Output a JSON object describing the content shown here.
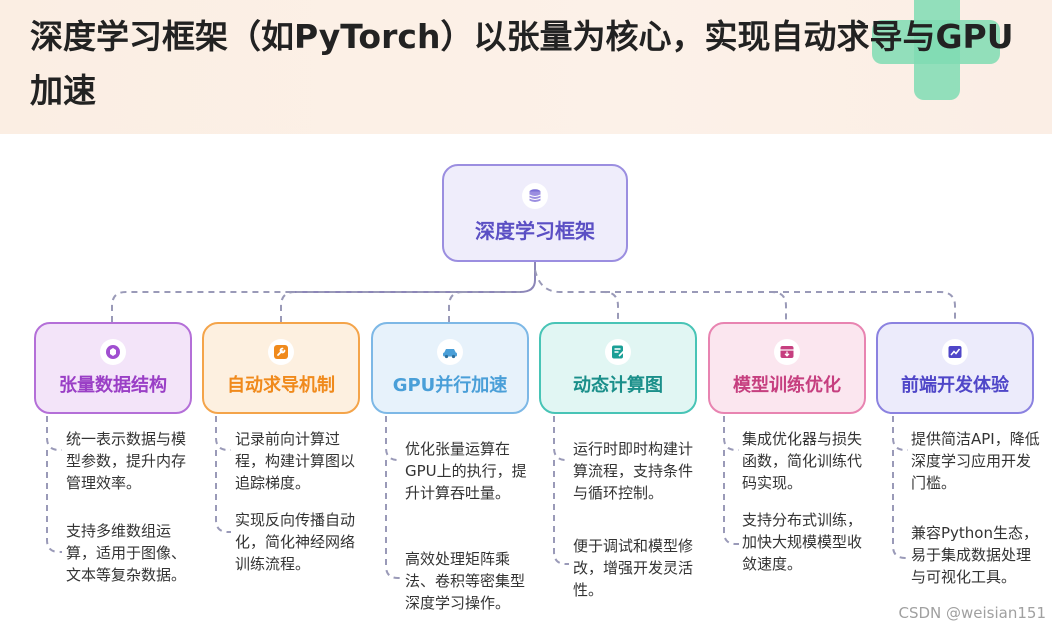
{
  "header": {
    "title": "深度学习框架（如PyTorch）以张量为核心，实现自动求导与GPU加速"
  },
  "root": {
    "label": "深度学习框架",
    "icon": "database-icon",
    "color": "#5b4fc4"
  },
  "branches": [
    {
      "label": "张量数据结构",
      "icon": "cube-icon",
      "color": "#9a3fc6",
      "bg": "#f3e4f9",
      "bullets": [
        "统一表示数据与模型参数，提升内存管理效率。",
        "支持多维数组运算，适用于图像、文本等复杂数据。"
      ]
    },
    {
      "label": "自动求导机制",
      "icon": "wrench-icon",
      "color": "#f08a1c",
      "bg": "#fdf0e0",
      "bullets": [
        "记录前向计算过程，构建计算图以追踪梯度。",
        "实现反向传播自动化，简化神经网络训练流程。"
      ]
    },
    {
      "label": "GPU并行加速",
      "icon": "car-icon",
      "color": "#4a9fd8",
      "bg": "#e7f2fb",
      "bullets": [
        "优化张量运算在GPU上的执行，提升计算吞吐量。",
        "高效处理矩阵乘法、卷积等密集型深度学习操作。"
      ]
    },
    {
      "label": "动态计算图",
      "icon": "note-edit-icon",
      "color": "#1a8f8a",
      "bg": "#e1f6f3",
      "bullets": [
        "运行时即时构建计算流程，支持条件与循环控制。",
        "便于调试和模型修改，增强开发灵活性。"
      ]
    },
    {
      "label": "模型训练优化",
      "icon": "inbox-icon",
      "color": "#c63f7f",
      "bg": "#fbe6ef",
      "bullets": [
        "集成优化器与损失函数，简化训练代码实现。",
        "支持分布式训练，加快大规模模型收敛速度。"
      ]
    },
    {
      "label": "前端开发体验",
      "icon": "chart-line-icon",
      "color": "#4f46c8",
      "bg": "#ecebfb",
      "bullets": [
        "提供简洁API，降低深度学习应用开发门槛。",
        "兼容Python生态，易于集成数据处理与可视化工具。"
      ]
    }
  ],
  "watermark": "CSDN @weisian151"
}
